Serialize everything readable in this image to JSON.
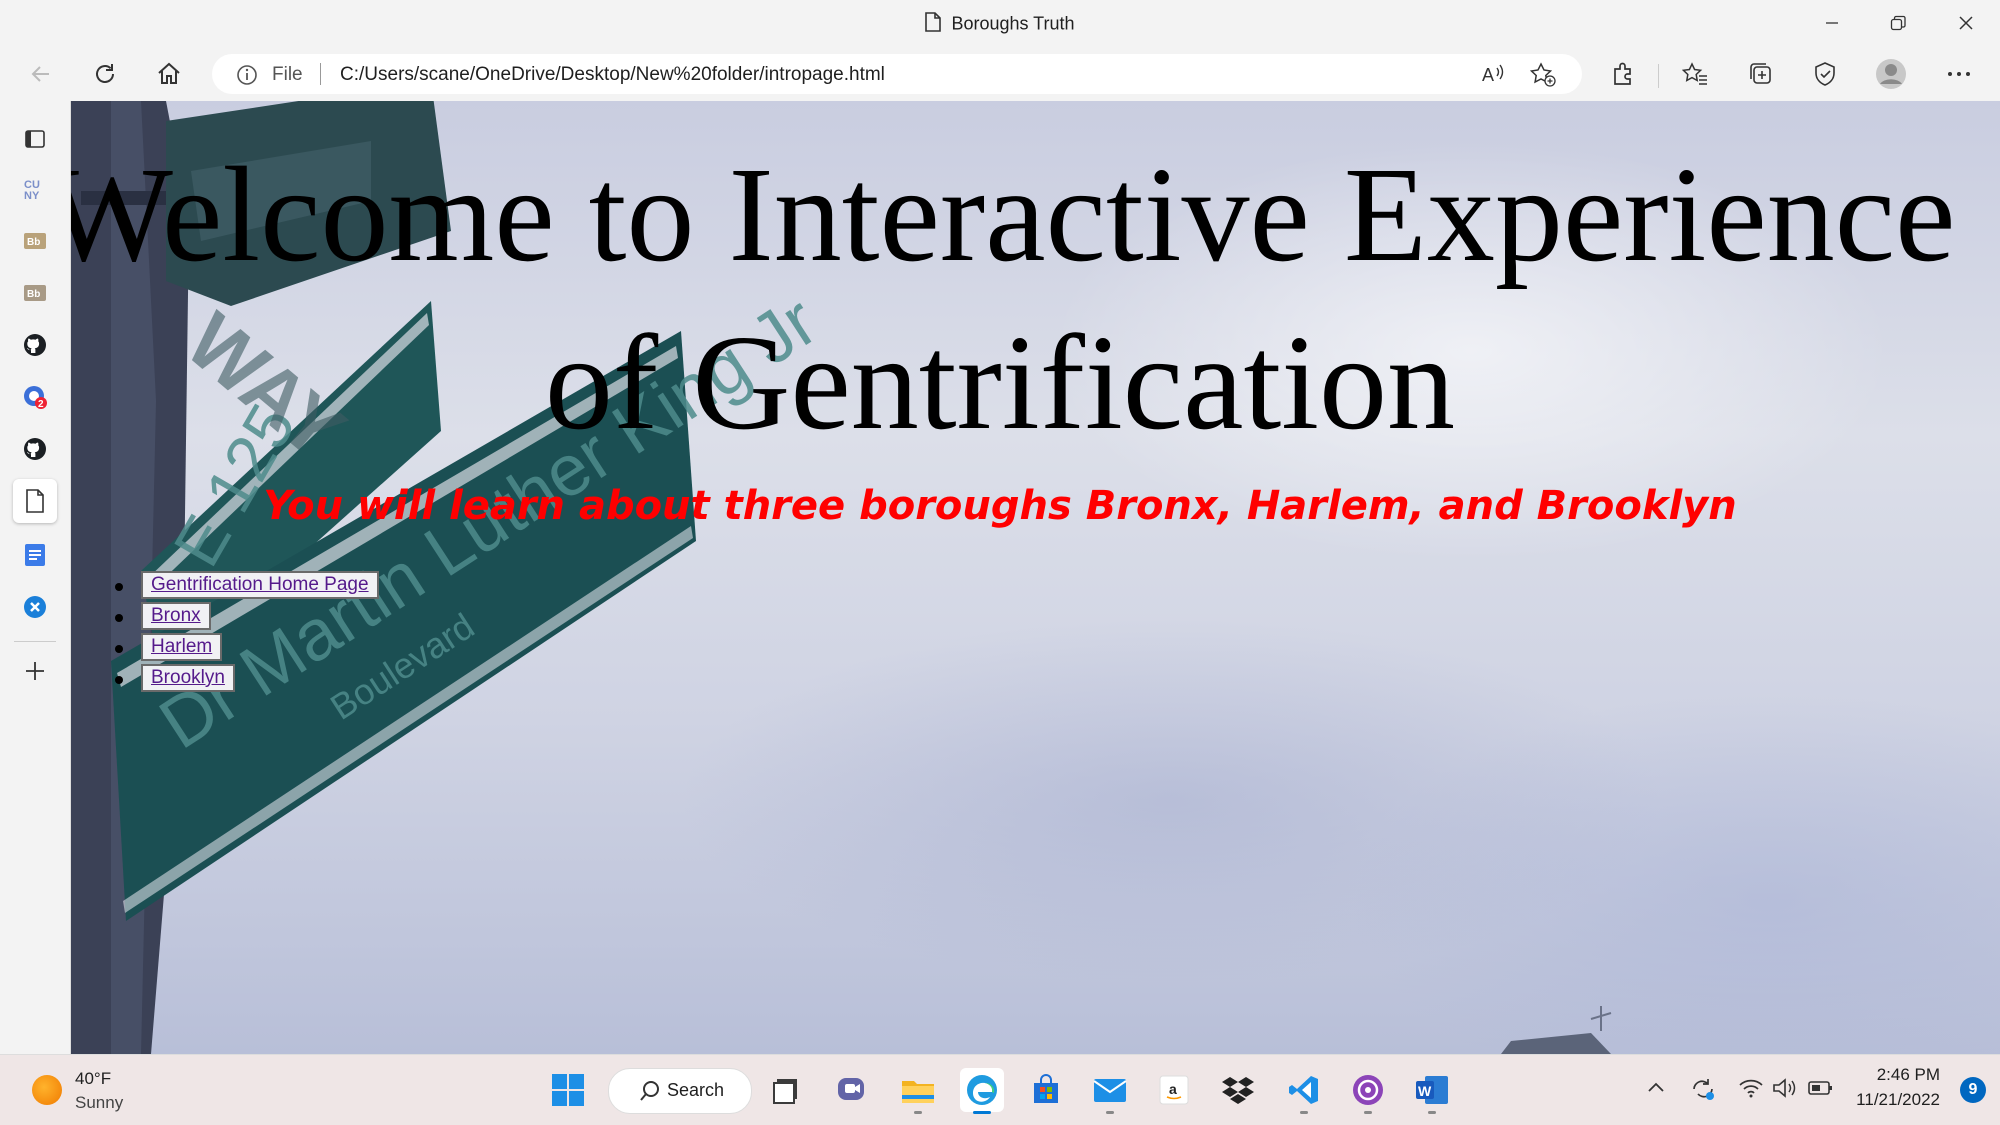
{
  "window": {
    "title": "Boroughs Truth"
  },
  "toolbar": {
    "file_label": "File",
    "url": "C:/Users/scane/OneDrive/Desktop/New%20folder/intropage.html"
  },
  "sidebar": {
    "items": [
      "tab-actions",
      "cuny",
      "blackboard",
      "blackboard",
      "github",
      "app-badge",
      "github",
      "page",
      "google-docs",
      "x-app",
      "add"
    ],
    "badge_count": "2"
  },
  "page": {
    "heading": "Welcome to Interactive Experience of Gentrification",
    "subheading": "You will learn about three boroughs Bronx, Harlem, and Brooklyn",
    "nav_links": [
      {
        "label": "Gentrification Home Page"
      },
      {
        "label": "Bronx"
      },
      {
        "label": "Harlem"
      },
      {
        "label": "Brooklyn"
      }
    ],
    "colors": {
      "subheading": "#ff0000",
      "link": "#551a8b"
    }
  },
  "taskbar": {
    "weather_temp": "40°F",
    "weather_cond": "Sunny",
    "search_label": "Search",
    "time": "2:46 PM",
    "date": "11/21/2022",
    "notification_count": "9"
  }
}
